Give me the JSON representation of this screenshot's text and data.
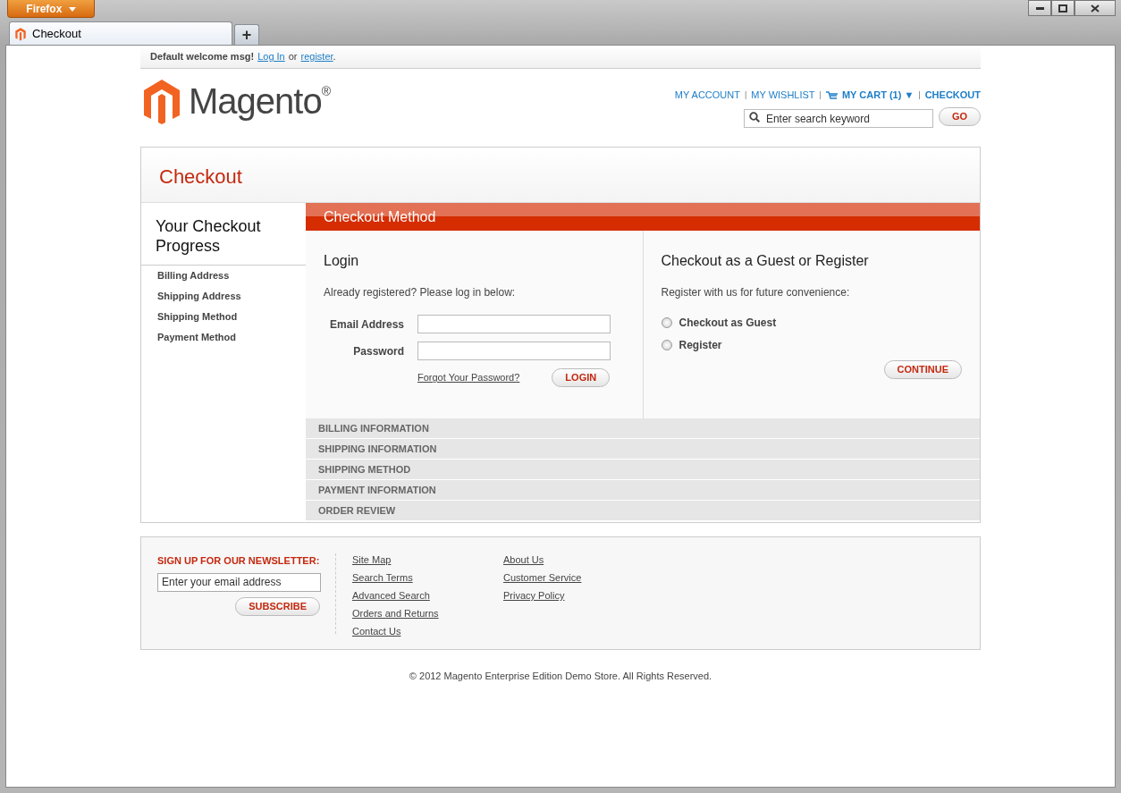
{
  "browser": {
    "menu_button": "Firefox",
    "tabs": [
      {
        "label": "Checkout",
        "selected": true
      }
    ],
    "new_tab": "+"
  },
  "header": {
    "welcome": "Default welcome msg!",
    "login_link": "Log In",
    "or": "or",
    "register_link": "register",
    "period": ".",
    "logo": "Magento$^{®}$",
    "links": [
      {
        "label": "MY ACCOUNT",
        "kind": "plain"
      },
      {
        "label": "MY WISHLIST",
        "kind": "plain",
        "separator": "|"
      },
      {
        "label": "MY CART (1)",
        "kind": "cart",
        "separator": "|",
        "caret": "▼"
      },
      {
        "label": "CHECKOUT",
        "kind": "strong",
        "separator": "|"
      }
    ],
    "search": {
      "placeholder": "Enter search keyword",
      "button": "GO"
    }
  },
  "page_title": "Checkout",
  "progress": {
    "title": "Your Checkout Progress",
    "items": [
      "Billing Address",
      "Shipping Address",
      "Shipping Method",
      "Payment Method"
    ]
  },
  "steps": [
    {
      "title": "Checkout Method",
      "expanded": true
    },
    {
      "title": "BILLING INFORMATION",
      "expanded": false
    },
    {
      "title": "SHIPPING INFORMATION",
      "expanded": false
    },
    {
      "title": "SHIPPING METHOD",
      "expanded": false
    },
    {
      "title": "PAYMENT INFORMATION",
      "expanded": false
    },
    {
      "title": "ORDER REVIEW",
      "expanded": false
    }
  ],
  "login": {
    "title": "Login",
    "intro": "Already registered? Please log in below:",
    "fields": [
      {
        "label": "Email Address"
      },
      {
        "label": "Password"
      }
    ],
    "forgot_link": "Forgot Your Password?",
    "button": "LOGIN"
  },
  "guest": {
    "title": "Checkout as a Guest or Register",
    "intro": "Register with us for future convenience:",
    "options": [
      {
        "label": "Checkout as Guest",
        "selected": false
      },
      {
        "label": "Register",
        "selected": false
      }
    ],
    "button": "CONTINUE"
  },
  "footer": {
    "newsletter": {
      "title": "SIGN UP FOR OUR NEWSLETTER:",
      "placeholder": "Enter your email address",
      "button": "SUBSCRIBE"
    },
    "link_columns": [
      [
        "Site Map",
        "Search Terms",
        "Advanced Search",
        "Orders and Returns",
        "Contact Us"
      ],
      [
        "About Us",
        "Customer Service",
        "Privacy Policy"
      ]
    ],
    "copyright": "© 2012 Magento Enterprise Edition Demo Store. All Rights Reserved."
  }
}
